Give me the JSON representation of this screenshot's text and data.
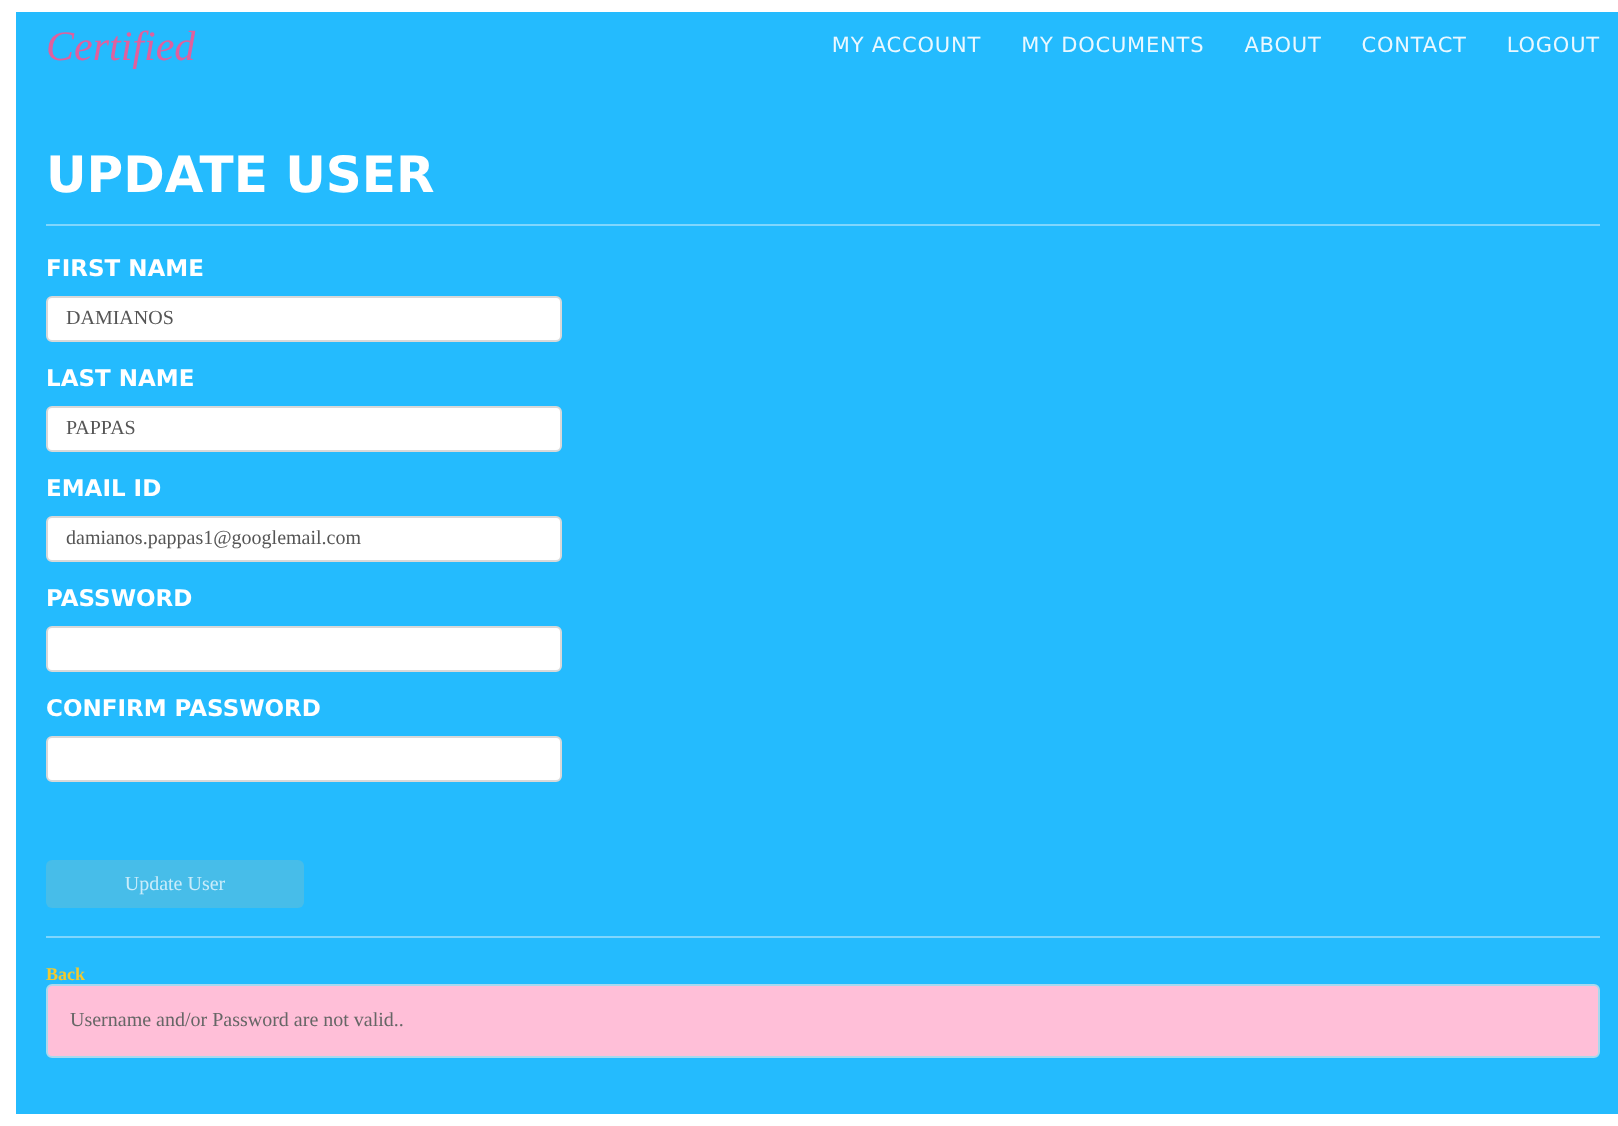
{
  "brand": "Certified",
  "nav": [
    {
      "label": "MY ACCOUNT"
    },
    {
      "label": "MY DOCUMENTS"
    },
    {
      "label": "ABOUT"
    },
    {
      "label": "CONTACT"
    },
    {
      "label": "LOGOUT"
    }
  ],
  "title": "UPDATE USER",
  "fields": [
    {
      "label": "FIRST NAME",
      "value": "DAMIANOS",
      "kind": "text"
    },
    {
      "label": "LAST NAME",
      "value": "PAPPAS",
      "kind": "text"
    },
    {
      "label": "EMAIL ID",
      "value": "damianos.pappas1@googlemail.com",
      "kind": "text"
    },
    {
      "label": "PASSWORD",
      "kind": "password"
    },
    {
      "label": "CONFIRM PASSWORD",
      "kind": "password"
    }
  ],
  "submit": {
    "label": "Update User",
    "disabled": true
  },
  "back_link": "Back",
  "alert": "Username and/or Password are not valid.."
}
